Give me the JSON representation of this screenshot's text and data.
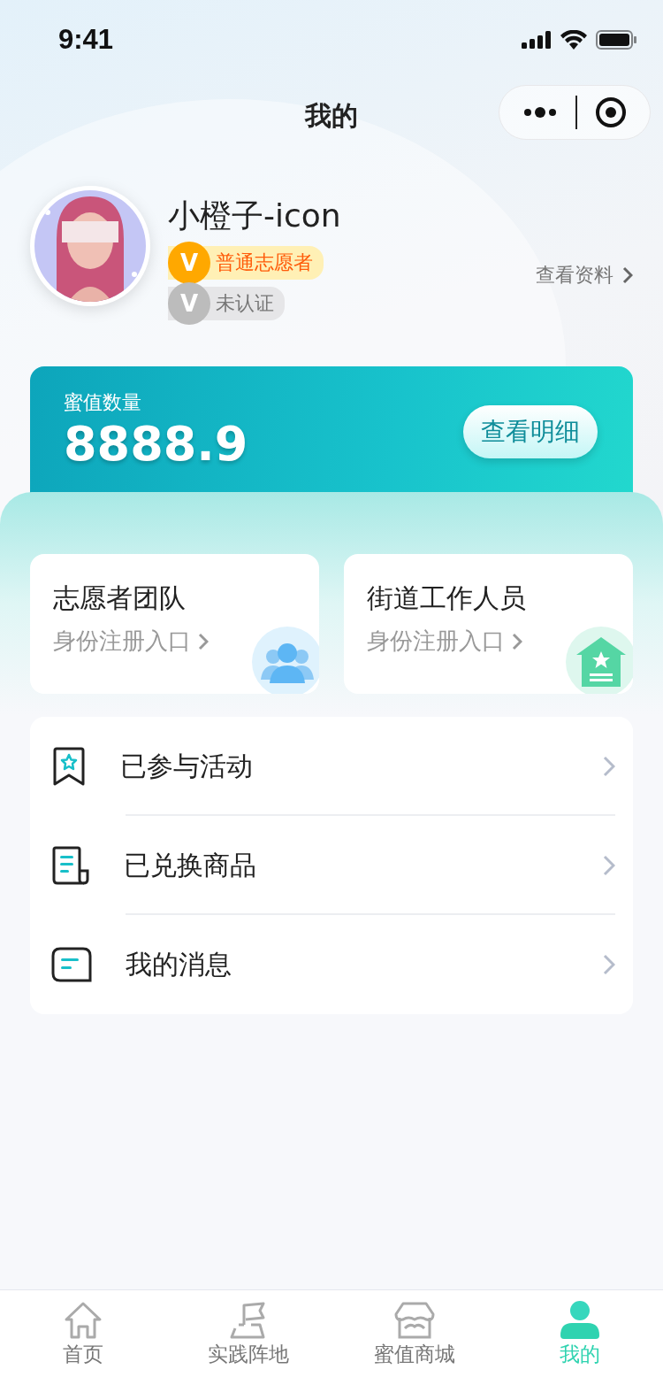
{
  "status_bar": {
    "time": "9:41"
  },
  "nav": {
    "title": "我的"
  },
  "profile": {
    "name": "小橙子-icon",
    "badges": [
      {
        "kind": "level",
        "icon": "V",
        "label": "普通志愿者"
      },
      {
        "kind": "unverified",
        "icon": "V",
        "label": "未认证"
      }
    ],
    "link": "查看资料"
  },
  "points_card": {
    "label": "蜜值数量",
    "value": "8888.9",
    "button": "查看明细"
  },
  "identity_cards": [
    {
      "kind": "team",
      "title": "志愿者团队",
      "subtitle": "身份注册入口"
    },
    {
      "kind": "street",
      "title": "街道工作人员",
      "subtitle": "身份注册入口"
    }
  ],
  "menu": [
    {
      "kind": "activity",
      "label": "已参与活动"
    },
    {
      "kind": "goods",
      "label": "已兑换商品"
    },
    {
      "kind": "message",
      "label": "我的消息"
    }
  ],
  "tab_bar": [
    {
      "kind": "home",
      "label": "首页",
      "selected": false
    },
    {
      "kind": "flag",
      "label": "实践阵地",
      "selected": false
    },
    {
      "kind": "shop",
      "label": "蜜值商城",
      "selected": false
    },
    {
      "kind": "me",
      "label": "我的",
      "selected": true
    }
  ]
}
